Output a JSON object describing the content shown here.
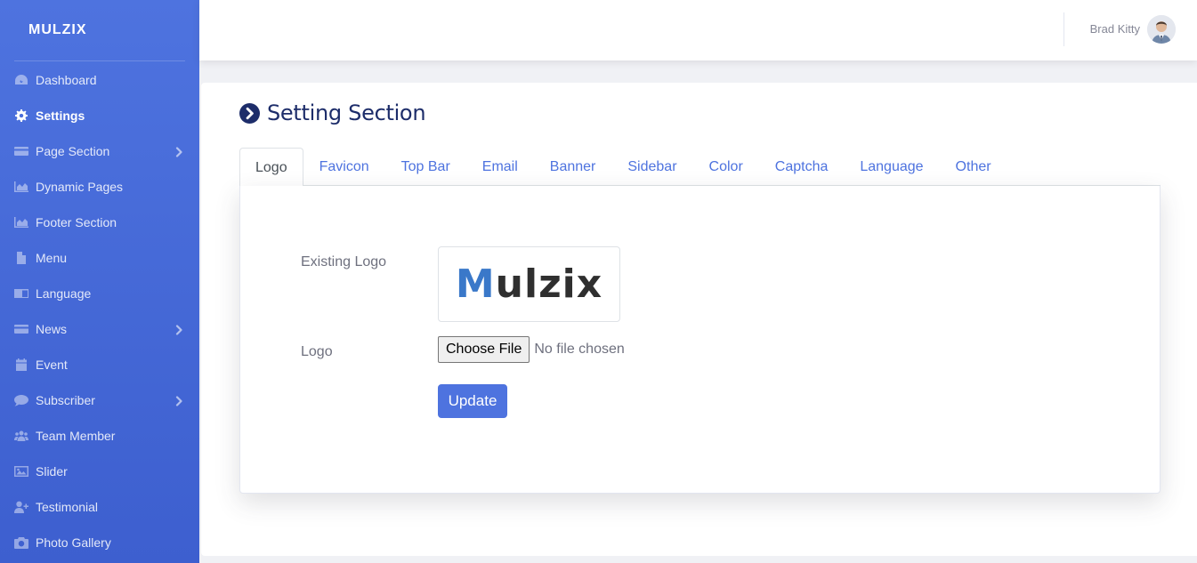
{
  "brand": {
    "name": "MULZIX"
  },
  "sidebar": {
    "items": [
      {
        "label": "Dashboard",
        "icon": "tachometer-icon",
        "active": false,
        "has_submenu": false
      },
      {
        "label": "Settings",
        "icon": "gear-icon",
        "active": true,
        "has_submenu": false
      },
      {
        "label": "Page Section",
        "icon": "card-icon",
        "active": false,
        "has_submenu": true
      },
      {
        "label": "Dynamic Pages",
        "icon": "chart-area-icon",
        "active": false,
        "has_submenu": false
      },
      {
        "label": "Footer Section",
        "icon": "chart-area-icon",
        "active": false,
        "has_submenu": false
      },
      {
        "label": "Menu",
        "icon": "file-icon",
        "active": false,
        "has_submenu": false
      },
      {
        "label": "Language",
        "icon": "language-icon",
        "active": false,
        "has_submenu": false
      },
      {
        "label": "News",
        "icon": "card-icon",
        "active": false,
        "has_submenu": true
      },
      {
        "label": "Event",
        "icon": "calendar-icon",
        "active": false,
        "has_submenu": false
      },
      {
        "label": "Subscriber",
        "icon": "comment-icon",
        "active": false,
        "has_submenu": true
      },
      {
        "label": "Team Member",
        "icon": "users-icon",
        "active": false,
        "has_submenu": false
      },
      {
        "label": "Slider",
        "icon": "image-icon",
        "active": false,
        "has_submenu": false
      },
      {
        "label": "Testimonial",
        "icon": "user-plus-icon",
        "active": false,
        "has_submenu": false
      },
      {
        "label": "Photo Gallery",
        "icon": "camera-icon",
        "active": false,
        "has_submenu": false
      }
    ]
  },
  "topbar": {
    "user_name": "Brad Kitty"
  },
  "page": {
    "title": "Setting Section"
  },
  "tabs": [
    {
      "label": "Logo",
      "active": true
    },
    {
      "label": "Favicon",
      "active": false
    },
    {
      "label": "Top Bar",
      "active": false
    },
    {
      "label": "Email",
      "active": false
    },
    {
      "label": "Banner",
      "active": false
    },
    {
      "label": "Sidebar",
      "active": false
    },
    {
      "label": "Color",
      "active": false
    },
    {
      "label": "Captcha",
      "active": false
    },
    {
      "label": "Language",
      "active": false
    },
    {
      "label": "Other",
      "active": false
    }
  ],
  "form": {
    "existing_logo_label": "Existing Logo",
    "existing_logo_text_m": "M",
    "existing_logo_text_rest": "ulzix",
    "logo_label": "Logo",
    "file_button": "Choose File",
    "file_status": "No file chosen",
    "update_button": "Update"
  },
  "colors": {
    "primary": "#4e73df",
    "title": "#1d2d6a",
    "logo_m": "#3a78c9"
  }
}
